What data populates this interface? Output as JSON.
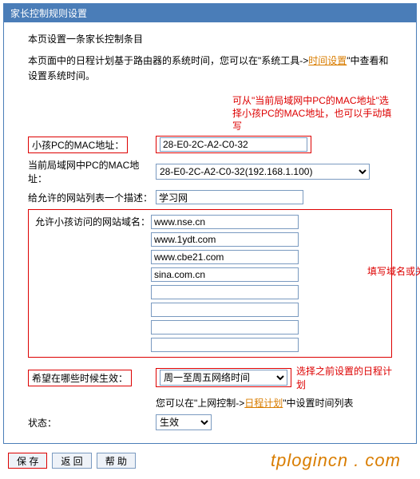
{
  "title": "家长控制规则设置",
  "heading": "本页设置一条家长控制条目",
  "intro_pre": "本页面中的日程计划基于路由器的系统时间，您可以在\"系统工具->",
  "intro_link": "时间设置",
  "intro_post": "\"中查看和设置系统时间。",
  "annot_mac": "可从\"当前局域网中PC的MAC地址\"选择小孩PC的MAC地址，也可以手动填写",
  "rows": {
    "child_mac_label": "小孩PC的MAC地址：",
    "child_mac_value": "28-E0-2C-A2-C0-32",
    "lan_mac_label": "当前局域网中PC的MAC地址：",
    "lan_mac_value": "28-E0-2C-A2-C0-32(192.168.1.100)",
    "desc_label": "给允许的网站列表一个描述：",
    "desc_value": "学习网"
  },
  "domains": {
    "label": "允许小孩访问的网站域名：",
    "values": [
      "www.nse.cn",
      "www.1ydt.com",
      "www.cbe21.com",
      "sina.com.cn",
      "",
      "",
      "",
      ""
    ],
    "annot": "填写域名或关键字"
  },
  "schedule": {
    "label": "希望在哪些时候生效：",
    "value": "周一至周五网络时间",
    "annot": "选择之前设置的日程计划",
    "note_pre": "您可以在\"上网控制->",
    "note_link": "日程计划",
    "note_post": "\"中设置时间列表"
  },
  "status": {
    "label": "状态：",
    "value": "生效"
  },
  "buttons": {
    "save": "保 存",
    "back": "返 回",
    "help": "帮 助"
  },
  "watermark": "tplogincn . com"
}
